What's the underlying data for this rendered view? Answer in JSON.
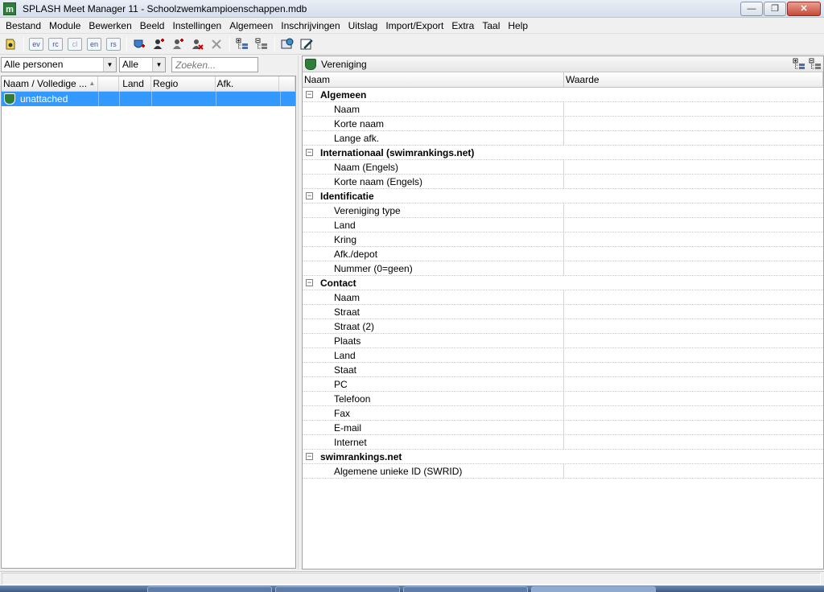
{
  "window": {
    "app_icon_letter": "m",
    "title": "SPLASH Meet Manager 11 - Schoolzwemkampioenschappen.mdb",
    "minimize": "—",
    "maximize": "❐",
    "close": "✕"
  },
  "menu": [
    "Bestand",
    "Module",
    "Bewerken",
    "Beeld",
    "Instellingen",
    "Algemeen",
    "Inschrijvingen",
    "Uitslag",
    "Import/Export",
    "Extra",
    "Taal",
    "Help"
  ],
  "toolbar": {
    "codes": [
      "ev",
      "rc",
      "cl",
      "en",
      "rs"
    ]
  },
  "filters": {
    "persons": "Alle personen",
    "scope": "Alle",
    "search_placeholder": "Zoeken..."
  },
  "list": {
    "columns": [
      "Naam / Volledige ...",
      "",
      "Land",
      "Regio",
      "Afk.",
      ""
    ],
    "rows": [
      {
        "name": "unattached",
        "flag": "",
        "land": "",
        "regio": "",
        "afk": ""
      }
    ]
  },
  "detail": {
    "title": "Vereniging",
    "columns": {
      "name": "Naam",
      "value": "Waarde"
    },
    "groups": [
      {
        "label": "Algemeen",
        "rows": [
          "Naam",
          "Korte naam",
          "Lange afk."
        ]
      },
      {
        "label": "Internationaal (swimrankings.net)",
        "rows": [
          "Naam (Engels)",
          "Korte naam (Engels)"
        ]
      },
      {
        "label": "Identificatie",
        "rows": [
          "Vereniging type",
          "Land",
          "Kring",
          "Afk./depot",
          "Nummer (0=geen)"
        ]
      },
      {
        "label": "Contact",
        "rows": [
          "Naam",
          "Straat",
          "Straat (2)",
          "Plaats",
          "Land",
          "Staat",
          "PC",
          "Telefoon",
          "Fax",
          "E-mail",
          "Internet"
        ]
      },
      {
        "label": "swimrankings.net",
        "rows": [
          "Algemene unieke ID (SWRID)"
        ]
      }
    ]
  },
  "colors": {
    "selection": "#3399ff",
    "club_icon": "#2f7d3a"
  }
}
